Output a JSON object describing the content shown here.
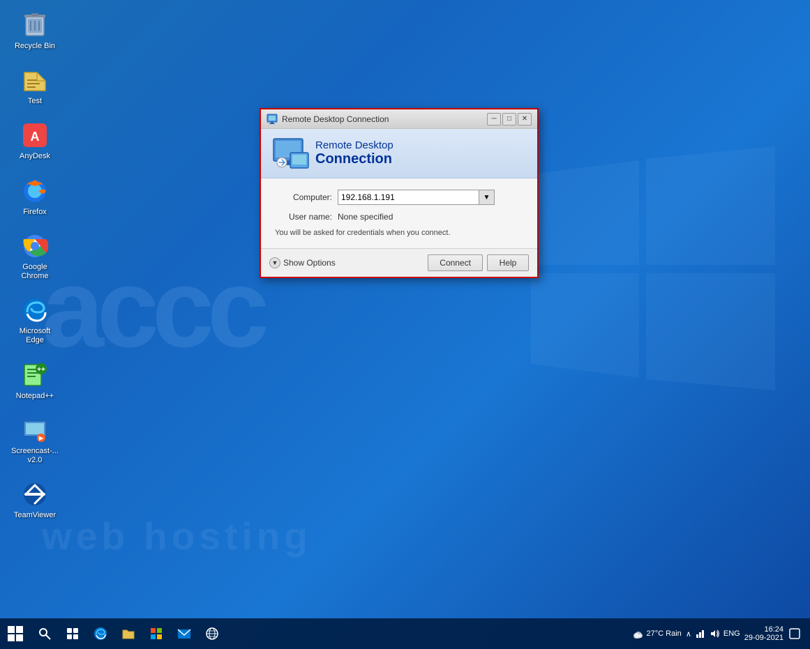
{
  "desktop": {
    "background_color": "#1565c0",
    "watermark_text": "accc",
    "watermark_subtext": "web hosting"
  },
  "icons": [
    {
      "id": "recycle-bin",
      "label": "Recycle Bin",
      "emoji": "🗑️"
    },
    {
      "id": "test",
      "label": "Test",
      "emoji": "📁"
    },
    {
      "id": "anydesk",
      "label": "AnyDesk",
      "emoji": "🔴"
    },
    {
      "id": "firefox",
      "label": "Firefox",
      "emoji": "🦊"
    },
    {
      "id": "google-chrome",
      "label": "Google Chrome",
      "emoji": "🌐"
    },
    {
      "id": "microsoft-edge",
      "label": "Microsoft Edge",
      "emoji": "🌊"
    },
    {
      "id": "notepadpp",
      "label": "Notepad++",
      "emoji": "📝"
    },
    {
      "id": "screencast",
      "label": "Screencast-...\nv2.0",
      "emoji": "🎬"
    },
    {
      "id": "teamviewer",
      "label": "TeamViewer",
      "emoji": "🔵"
    }
  ],
  "dialog": {
    "title": "Remote Desktop Connection",
    "header_line1": "Remote Desktop",
    "header_line2": "Connection",
    "computer_label": "Computer:",
    "computer_value": "192.168.1.191",
    "username_label": "User name:",
    "username_value": "None specified",
    "credentials_note": "You will be asked for credentials when you connect.",
    "show_options_label": "Show Options",
    "connect_button": "Connect",
    "help_button": "Help"
  },
  "taskbar": {
    "weather": "27°C Rain",
    "time": "16:24",
    "date": "29-09-2021",
    "language": "ENG"
  }
}
